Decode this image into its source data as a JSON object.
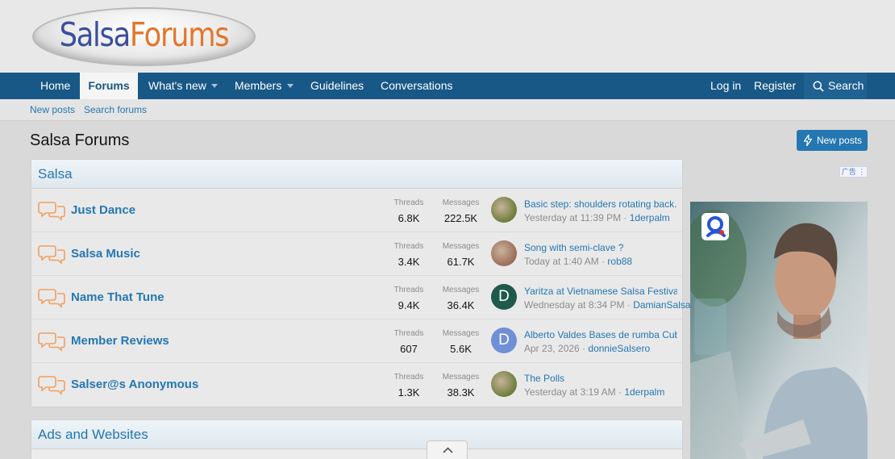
{
  "header": {
    "logo_part1": "Salsa",
    "logo_part2": "Forums"
  },
  "nav": {
    "home": "Home",
    "forums": "Forums",
    "whats_new": "What's new",
    "members": "Members",
    "guidelines": "Guidelines",
    "conversations": "Conversations",
    "login": "Log in",
    "register": "Register",
    "search": "Search"
  },
  "subnav": {
    "new_posts": "New posts",
    "search_forums": "Search forums"
  },
  "page": {
    "title": "Salsa Forums",
    "new_posts_button": "New posts"
  },
  "salsa_block": {
    "title": "Salsa",
    "forums": [
      {
        "name": "Just Dance",
        "threads_label": "Threads",
        "threads": "6.8K",
        "messages_label": "Messages",
        "messages": "222.5K",
        "last_title": "Basic step: shoulders rotating back...",
        "last_time": "Yesterday at 11:39 PM",
        "last_user": "1derpalm",
        "avatar": "",
        "avatar_color": "#6b7d3b"
      },
      {
        "name": "Salsa Music",
        "threads_label": "Threads",
        "threads": "3.4K",
        "messages_label": "Messages",
        "messages": "61.7K",
        "last_title": "Song with semi-clave ?",
        "last_time": "Today at 1:40 AM",
        "last_user": "rob88",
        "avatar": "",
        "avatar_color": "#9c6b5a"
      },
      {
        "name": "Name That Tune",
        "threads_label": "Threads",
        "threads": "9.4K",
        "messages_label": "Messages",
        "messages": "36.4K",
        "last_title": "Yaritza at Vietnamese Salsa Festival",
        "last_time": "Wednesday at 8:34 PM",
        "last_user": "DamianSalsa",
        "avatar": "D",
        "avatar_color": "#1e5a4a"
      },
      {
        "name": "Member Reviews",
        "threads_label": "Threads",
        "threads": "607",
        "messages_label": "Messages",
        "messages": "5.6K",
        "last_title": "Alberto Valdes Bases de rumba Cub...",
        "last_time": "Apr 23, 2026",
        "last_user": "donnieSalsero",
        "avatar": "D",
        "avatar_color": "#6f8fd6"
      },
      {
        "name": "Salser@s Anonymous",
        "threads_label": "Threads",
        "threads": "1.3K",
        "messages_label": "Messages",
        "messages": "38.3K",
        "last_title": "The Polls",
        "last_time": "Yesterday at 3:19 AM",
        "last_user": "1derpalm",
        "avatar": "",
        "avatar_color": "#6b7d3b"
      }
    ]
  },
  "ads_block": {
    "title": "Ads and Websites"
  },
  "ad": {
    "label": "广告 ⋮"
  },
  "colors": {
    "primary": "#185886",
    "link": "#2577b1",
    "accent_orange": "#e3762b"
  }
}
